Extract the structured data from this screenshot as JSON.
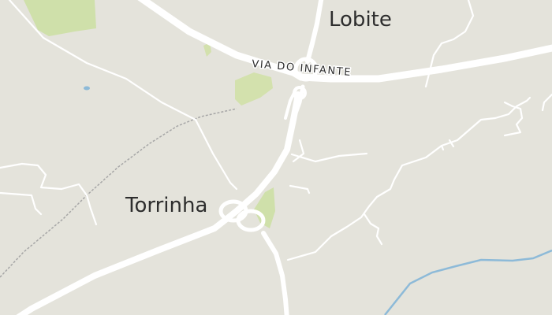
{
  "map": {
    "places": {
      "lobite": "Lobite",
      "torrinha": "Torrinha"
    },
    "roads": {
      "via_do_infante": "VIA DO INFANTE"
    },
    "colors": {
      "land": "#e4e3db",
      "park": "#cfe0aa",
      "road": "#ffffff",
      "water": "#8dbad8",
      "rail": "#a6a6a6"
    }
  }
}
